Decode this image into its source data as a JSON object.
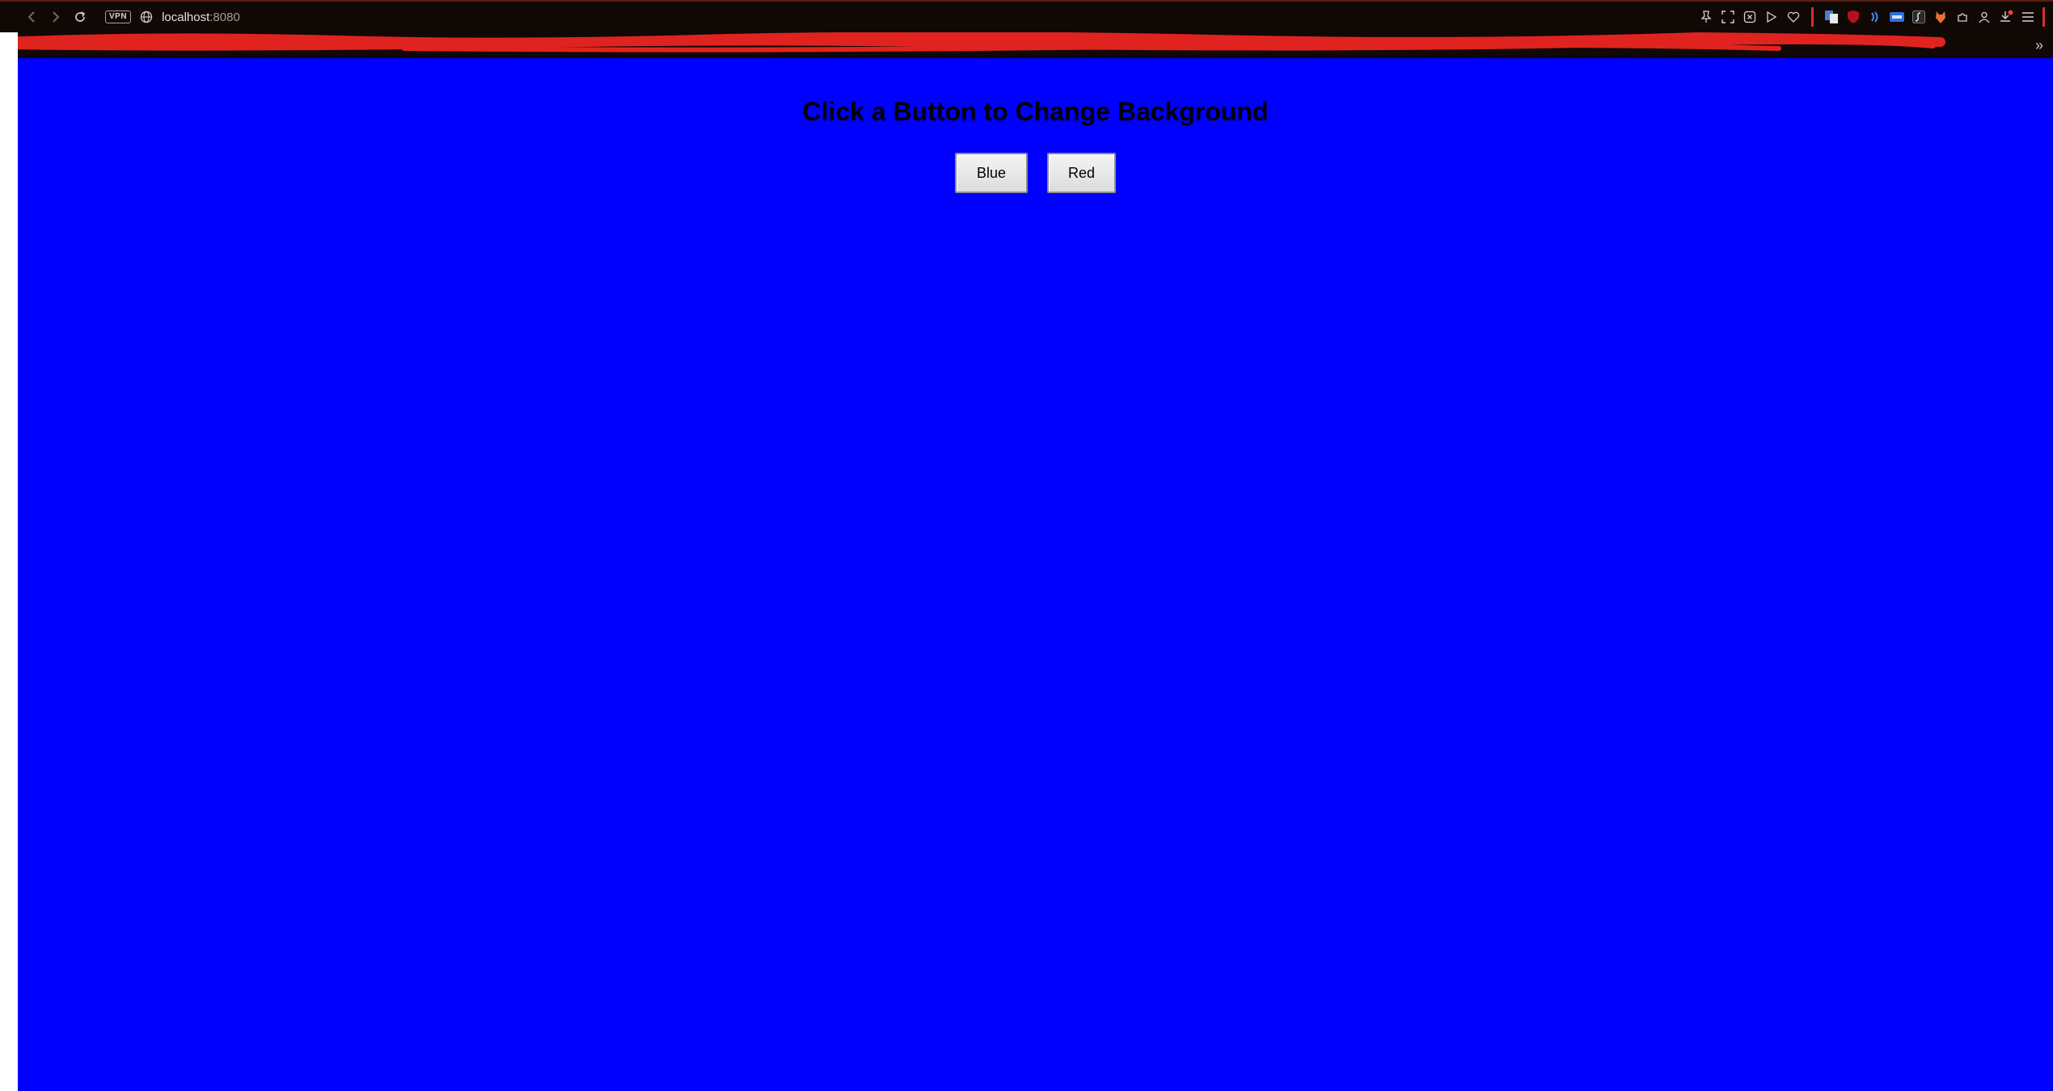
{
  "browser": {
    "url_host": "localhost",
    "url_port": ":8080",
    "vpn_label": "VPN",
    "nav": {
      "back_icon": "chevron-left-icon",
      "forward_icon": "chevron-right-icon",
      "reload_icon": "reload-icon"
    },
    "extensions": [
      "pin-icon",
      "screenshot-icon",
      "close-circle-icon",
      "play-icon",
      "heart-icon",
      "translate-icon",
      "ublock-icon",
      "wave-icon",
      "new-badge-icon",
      "script-icon",
      "fox-icon",
      "puzzle-icon",
      "account-icon",
      "download-icon",
      "menu-icon"
    ]
  },
  "page": {
    "title": "Click a Button to Change Background",
    "background_color": "#0000ff",
    "buttons": {
      "blue_label": "Blue",
      "red_label": "Red"
    }
  }
}
